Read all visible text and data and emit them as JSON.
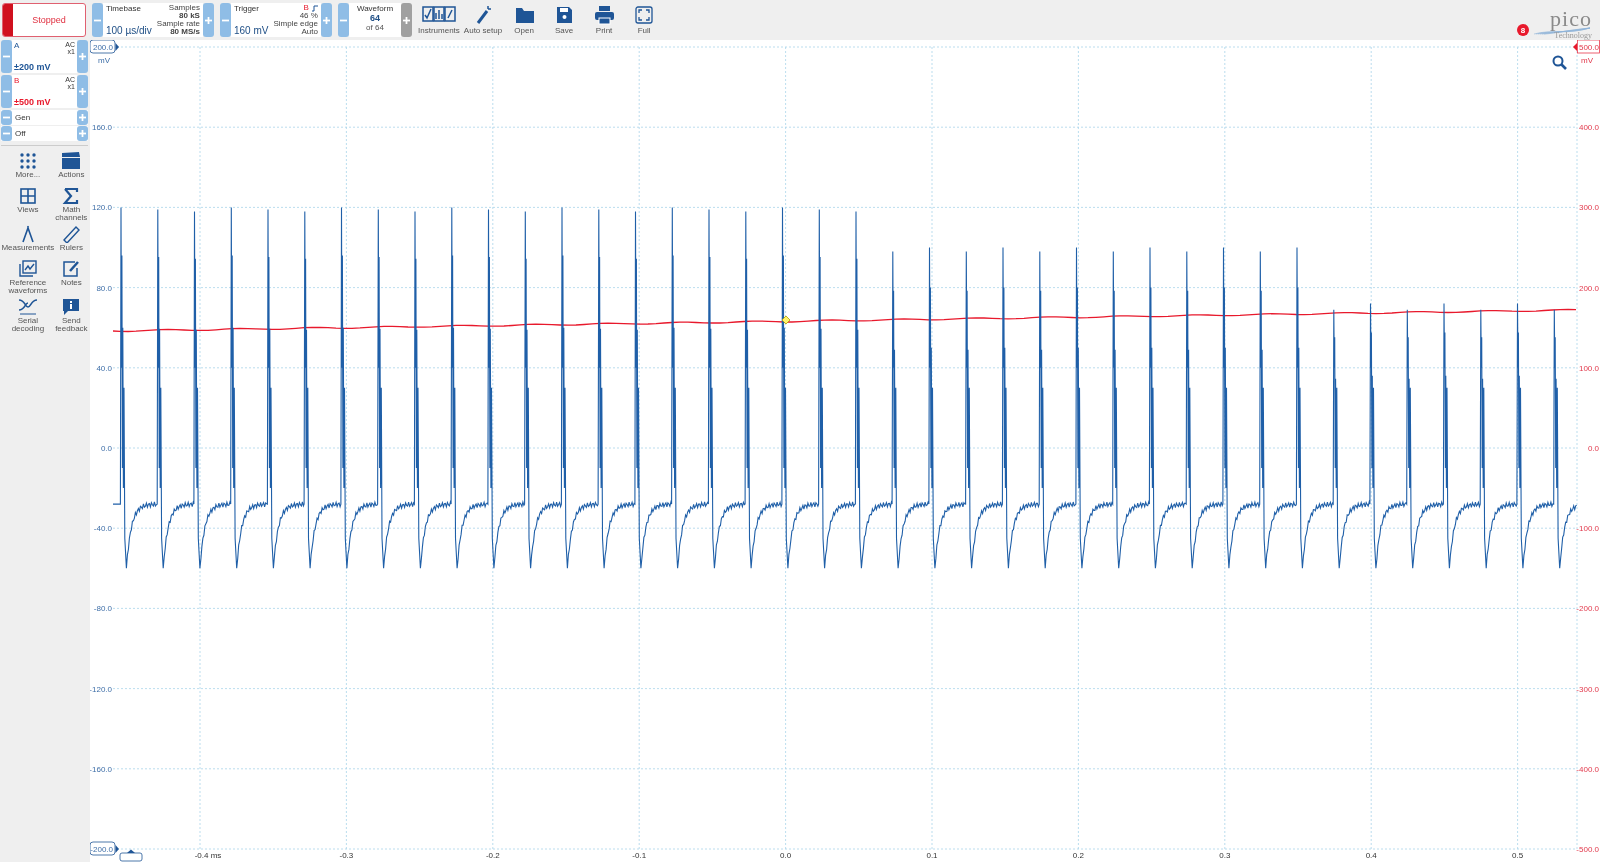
{
  "status": {
    "label": "Stopped"
  },
  "timebase": {
    "title": "Timebase",
    "value": "100 µs/div",
    "info": [
      "Samples",
      "80 kS",
      "Sample rate",
      "80 MS/s"
    ]
  },
  "trigger": {
    "title": "Trigger",
    "value": "160 mV",
    "source": "B",
    "info": [
      "46 %",
      "Simple edge",
      "Auto"
    ]
  },
  "waveform": {
    "title": "Waveform",
    "value": "64",
    "total": "of 64",
    "next_disabled": true
  },
  "toolbar": [
    {
      "label": "Instruments",
      "kind": "instruments"
    },
    {
      "label": "Auto setup",
      "kind": "wand"
    },
    {
      "label": "Open",
      "kind": "folder"
    },
    {
      "label": "Save",
      "kind": "save"
    },
    {
      "label": "Print",
      "kind": "print"
    },
    {
      "label": "Full",
      "kind": "full"
    }
  ],
  "logo": {
    "name": "pico",
    "tagline": "Technology"
  },
  "notification_count": "8",
  "channels": [
    {
      "name": "A",
      "coupling": "AC",
      "probe": "x1",
      "range": "±200 mV",
      "color": "#1f5596"
    },
    {
      "name": "B",
      "coupling": "AC",
      "probe": "x1",
      "range": "±500 mV",
      "color": "#e8192c"
    }
  ],
  "generator": {
    "label": "Gen",
    "value": "Off"
  },
  "tools": [
    {
      "label": "More...",
      "kind": "more"
    },
    {
      "label": "Actions",
      "kind": "actions"
    },
    {
      "label": "Views",
      "kind": "views"
    },
    {
      "label": "Math channels",
      "kind": "math"
    },
    {
      "label": "Measurements",
      "kind": "measure"
    },
    {
      "label": "Rulers",
      "kind": "ruler"
    },
    {
      "label": "Reference waveforms",
      "kind": "reference"
    },
    {
      "label": "Notes",
      "kind": "notes"
    },
    {
      "label": "Serial decoding",
      "kind": "serial"
    },
    {
      "label": "Send feedback",
      "kind": "feedback"
    }
  ],
  "plot": {
    "left_axis": {
      "unit": "mV",
      "ticks": [
        "200.0",
        "160.0",
        "120.0",
        "80.0",
        "40.0",
        "0.0",
        "-40.0",
        "-80.0",
        "-120.0",
        "-160.0",
        "-200.0"
      ]
    },
    "right_axis": {
      "unit": "mV",
      "ticks": [
        "500.0",
        "400.0",
        "300.0",
        "200.0",
        "100.0",
        "0.0",
        "-100.0",
        "-200.0",
        "-300.0",
        "-400.0",
        "-500.0"
      ]
    },
    "x_axis": {
      "ticks": [
        "-0.4 ms",
        "-0.3",
        "-0.2",
        "-0.1",
        "0.0",
        "0.1",
        "0.2",
        "0.3",
        "0.4",
        "0.5"
      ]
    }
  }
}
